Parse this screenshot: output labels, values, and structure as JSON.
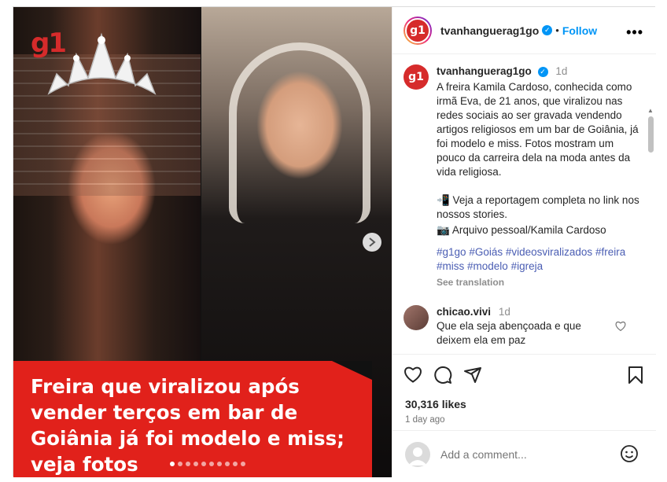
{
  "media": {
    "watermark": "g1",
    "overlay_caption": "Freira que viralizou após vender terços em bar de Goiânia já foi modelo e miss; veja fotos",
    "carousel_dot_count": 10,
    "active_dot": 0
  },
  "header": {
    "username": "tvanhanguerag1go",
    "separator": "•",
    "follow_label": "Follow",
    "more_label": "•••",
    "avatar_text": "g1"
  },
  "post": {
    "username": "tvanhanguerag1go",
    "time": "1d",
    "caption": "A freira Kamila Cardoso, conhecida como irmã Eva, de 21 anos, que viralizou nas redes sociais ao ser gravada vendendo artigos religiosos em um bar de Goiânia, já foi modelo e miss. Fotos mostram um pouco da carreira dela na moda antes da vida religiosa.",
    "line_report": "📲 Veja a reportagem completa no link nos nossos stories.",
    "line_credit": "📷 Arquivo pessoal/Kamila Cardoso",
    "hashtags": [
      "#g1go",
      "#Goiás",
      "#videosviralizados",
      "#freira",
      "#miss",
      "#modelo",
      "#igreja"
    ],
    "see_translation": "See translation"
  },
  "comment": {
    "username": "chicao.vivi",
    "time": "1d",
    "text": "Que ela seja abençoada e que deixem ela em paz"
  },
  "stats": {
    "likes": "30,316 likes",
    "posted": "1 day ago"
  },
  "composer": {
    "placeholder": "Add a comment..."
  },
  "colors": {
    "accent": "#0095f6",
    "brand_red": "#e1211b",
    "hashtag": "#4a5db3"
  }
}
